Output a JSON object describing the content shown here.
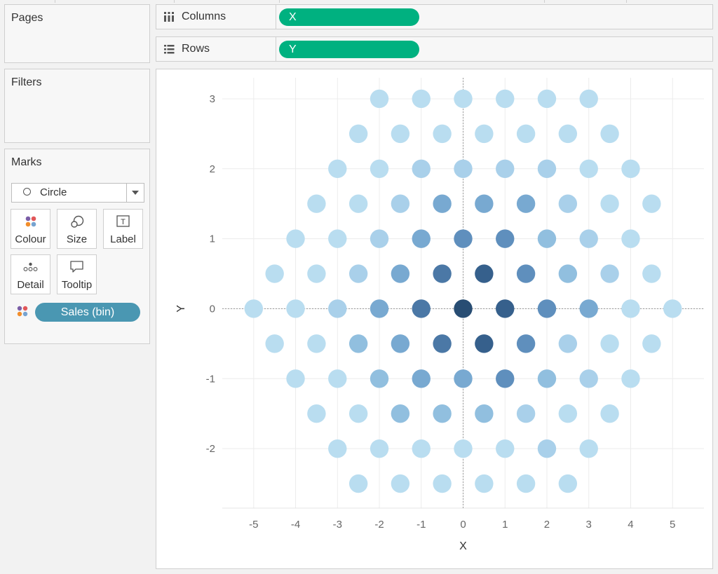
{
  "cards": {
    "pages_title": "Pages",
    "filters_title": "Filters",
    "marks_title": "Marks"
  },
  "shelves": {
    "columns_label": "Columns",
    "columns_pill": "X",
    "rows_label": "Rows",
    "rows_pill": "Y"
  },
  "marks": {
    "mark_type": "Circle",
    "buttons": [
      "Colour",
      "Size",
      "Label",
      "Detail",
      "Tooltip"
    ],
    "color_field": "Sales (bin)"
  },
  "colors": {
    "pill_green": "#00b180",
    "pill_blue": "#4a97b2",
    "scale": [
      "#b9ddf0",
      "#a9d0ea",
      "#91bfdf",
      "#78a9d1",
      "#5f8fbd",
      "#4b78a6",
      "#36608c",
      "#284d73"
    ]
  },
  "chart_data": {
    "type": "scatter",
    "title": "",
    "xlabel": "X",
    "ylabel": "Y",
    "xlim": [
      -5.75,
      5.75
    ],
    "ylim": [
      -2.85,
      3.3
    ],
    "xticks": [
      "-5",
      "-4",
      "-3",
      "-2",
      "-1",
      "0",
      "1",
      "2",
      "3",
      "4",
      "5"
    ],
    "yticks": [
      "-2",
      "-1",
      "0",
      "1",
      "2",
      "3"
    ],
    "grid": true,
    "zero_lines": true,
    "points": [
      {
        "y": 3,
        "x": [
          -2,
          -1,
          0,
          1,
          2,
          3
        ],
        "level": [
          0,
          0,
          0,
          0,
          0,
          0
        ]
      },
      {
        "y": 2.5,
        "x": [
          -2.5,
          -1.5,
          -0.5,
          0.5,
          1.5,
          2.5,
          3.5
        ],
        "level": [
          0,
          0,
          0,
          0,
          0,
          0,
          0
        ]
      },
      {
        "y": 2,
        "x": [
          -3,
          -2,
          -1,
          0,
          1,
          2,
          3,
          4
        ],
        "level": [
          0,
          0,
          1,
          1,
          1,
          1,
          0,
          0
        ]
      },
      {
        "y": 1.5,
        "x": [
          -3.5,
          -2.5,
          -1.5,
          -0.5,
          0.5,
          1.5,
          2.5,
          3.5,
          4.5
        ],
        "level": [
          0,
          0,
          1,
          3,
          3,
          3,
          1,
          0,
          0
        ]
      },
      {
        "y": 1,
        "x": [
          -4,
          -3,
          -2,
          -1,
          0,
          1,
          2,
          3,
          4
        ],
        "level": [
          0,
          0,
          1,
          3,
          4,
          4,
          2,
          1,
          0
        ]
      },
      {
        "y": 0.5,
        "x": [
          -4.5,
          -3.5,
          -2.5,
          -1.5,
          -0.5,
          0.5,
          1.5,
          2.5,
          3.5,
          4.5
        ],
        "level": [
          0,
          0,
          1,
          3,
          5,
          6,
          4,
          2,
          1,
          0
        ]
      },
      {
        "y": 0,
        "x": [
          -5,
          -4,
          -3,
          -2,
          -1,
          0,
          1,
          2,
          3,
          4,
          5
        ],
        "level": [
          0,
          0,
          1,
          3,
          5,
          7,
          6,
          4,
          3,
          0,
          0
        ]
      },
      {
        "y": -0.5,
        "x": [
          -4.5,
          -3.5,
          -2.5,
          -1.5,
          -0.5,
          0.5,
          1.5,
          2.5,
          3.5,
          4.5
        ],
        "level": [
          0,
          0,
          2,
          3,
          5,
          6,
          4,
          1,
          0,
          0
        ]
      },
      {
        "y": -1,
        "x": [
          -4,
          -3,
          -2,
          -1,
          0,
          1,
          2,
          3,
          4
        ],
        "level": [
          0,
          0,
          2,
          3,
          3,
          4,
          2,
          1,
          0
        ]
      },
      {
        "y": -1.5,
        "x": [
          -3.5,
          -2.5,
          -1.5,
          -0.5,
          0.5,
          1.5,
          2.5,
          3.5
        ],
        "level": [
          0,
          0,
          2,
          2,
          2,
          1,
          0,
          0
        ]
      },
      {
        "y": -2,
        "x": [
          -3,
          -2,
          -1,
          0,
          1,
          2,
          3
        ],
        "level": [
          0,
          0,
          0,
          0,
          0,
          1,
          0
        ]
      },
      {
        "y": -2.5,
        "x": [
          -2.5,
          -1.5,
          -0.5,
          0.5,
          1.5,
          2.5
        ],
        "level": [
          0,
          0,
          0,
          0,
          0,
          0
        ]
      }
    ]
  }
}
